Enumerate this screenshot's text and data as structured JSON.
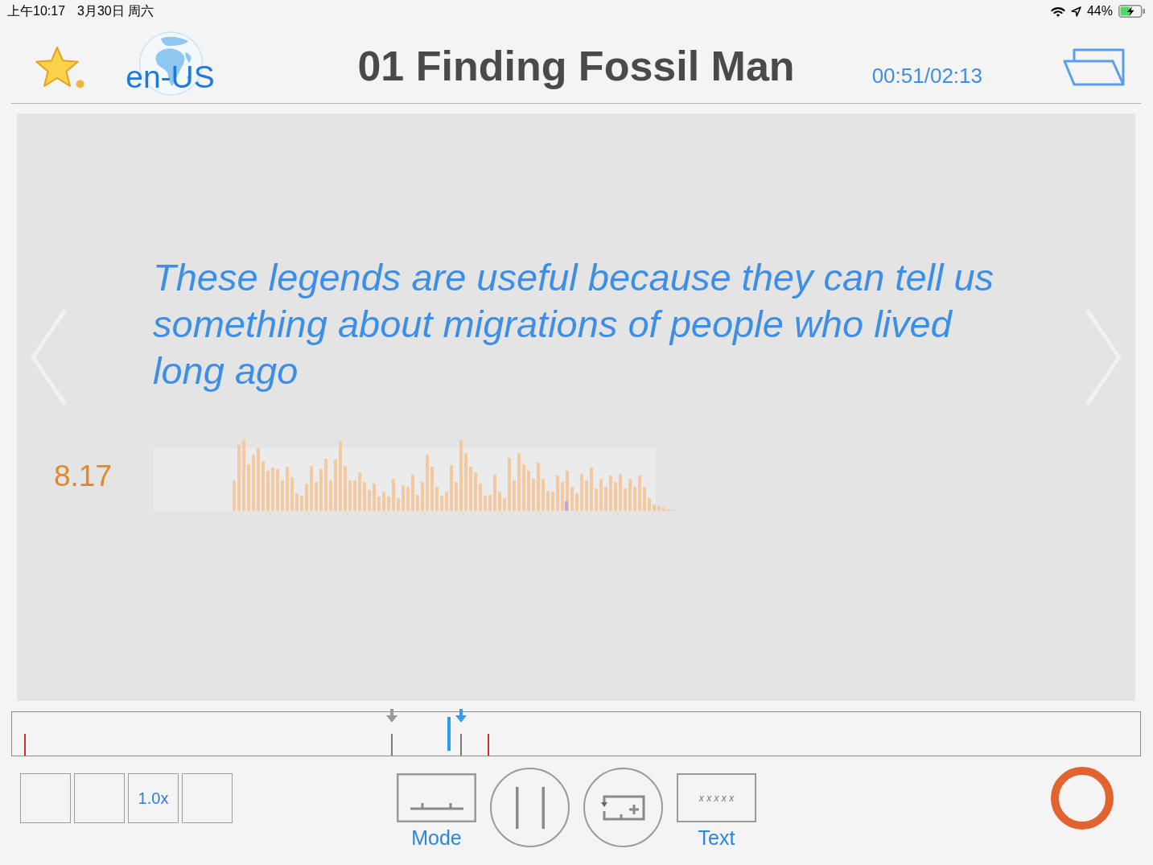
{
  "status_bar": {
    "time": "上午10:17",
    "date": "3月30日 周六",
    "battery": "44%"
  },
  "header": {
    "language": "en-US",
    "title": "01 Finding Fossil Man",
    "time": "00:51/02:13"
  },
  "sentence": {
    "text": "These legends are useful because they can tell us something about migrations of people who lived long ago",
    "score": "8.17"
  },
  "timeline": {
    "level": 0.387
  },
  "slots": [
    {
      "kind": "blank"
    },
    {
      "kind": "blank"
    },
    {
      "kind": "speed",
      "label": "1.0x"
    },
    {
      "kind": "blank"
    }
  ],
  "controls": [
    {
      "kind": "mode",
      "label": "Mode"
    },
    {
      "kind": "pause"
    },
    {
      "kind": "loop_add"
    },
    {
      "kind": "text",
      "label": "Text",
      "preview": "x x x x x"
    },
    {
      "kind": "ring"
    }
  ]
}
